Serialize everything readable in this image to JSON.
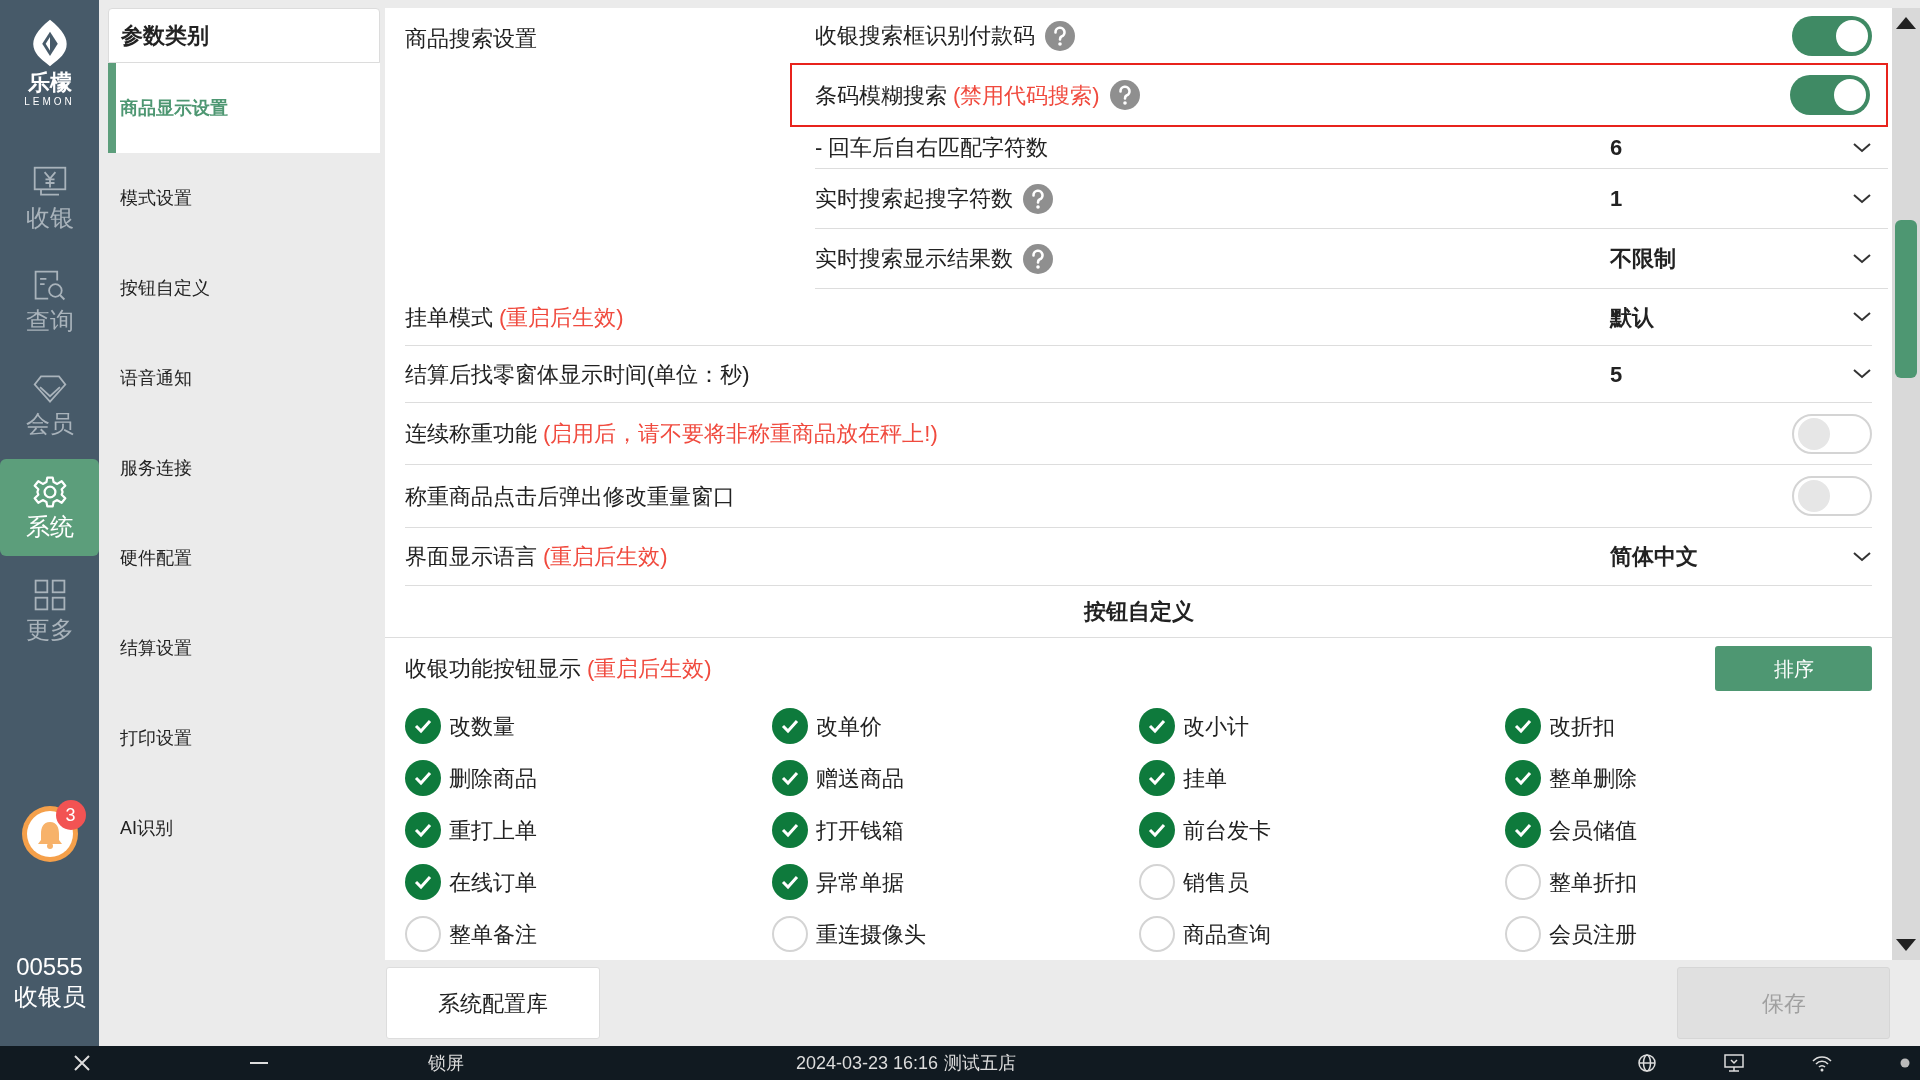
{
  "nav": {
    "logo_text": "乐檬",
    "logo_subtext": "LEMON",
    "items": [
      {
        "label": "收银",
        "kind": "register",
        "selected": false
      },
      {
        "label": "查询",
        "kind": "query",
        "selected": false
      },
      {
        "label": "会员",
        "kind": "member",
        "selected": false
      },
      {
        "label": "系统",
        "kind": "gear",
        "selected": true
      },
      {
        "label": "更多",
        "kind": "grid",
        "selected": false
      }
    ],
    "notification_count": "3",
    "user_id": "00555",
    "user_role": "收银员"
  },
  "categories": {
    "title": "参数类别",
    "items": [
      {
        "label": "商品显示设置",
        "selected": true
      },
      {
        "label": "模式设置",
        "selected": false
      },
      {
        "label": "按钮自定义",
        "selected": false
      },
      {
        "label": "语音通知",
        "selected": false
      },
      {
        "label": "服务连接",
        "selected": false
      },
      {
        "label": "硬件配置",
        "selected": false
      },
      {
        "label": "结算设置",
        "selected": false
      },
      {
        "label": "打印设置",
        "selected": false
      },
      {
        "label": "AI识别",
        "selected": false
      }
    ]
  },
  "search_settings": {
    "label": "商品搜索设置",
    "rows": [
      {
        "kind": "toggle",
        "label": "收银搜索框识别付款码",
        "help": true,
        "on": true,
        "highlighted": false
      },
      {
        "kind": "toggle",
        "label": "条码模糊搜索",
        "note": "(禁用代码搜索)",
        "help": true,
        "on": true,
        "highlighted": true
      },
      {
        "kind": "select",
        "label": "- 回车后自右匹配字符数",
        "help": false,
        "value": "6",
        "highlighted": false
      },
      {
        "kind": "select",
        "label": "实时搜索起搜字符数",
        "help": true,
        "value": "1",
        "highlighted": false
      },
      {
        "kind": "select",
        "label": "实时搜索显示结果数",
        "help": true,
        "value": "不限制",
        "highlighted": false
      }
    ]
  },
  "settings": [
    {
      "kind": "select",
      "label": "挂单模式",
      "note": "(重启后生效)",
      "value": "默认"
    },
    {
      "kind": "select",
      "label": "结算后找零窗体显示时间(单位：秒)",
      "value": "5"
    },
    {
      "kind": "toggle",
      "label": "连续称重功能",
      "note": "(启用后，请不要将非称重商品放在秤上!)",
      "on": false
    },
    {
      "kind": "toggle",
      "label": "称重商品点击后弹出修改重量窗口",
      "on": false
    },
    {
      "kind": "select",
      "label": "界面显示语言",
      "note": "(重启后生效)",
      "value": "简体中文"
    }
  ],
  "button_section": {
    "title": "按钮自定义",
    "label": "收银功能按钮显示",
    "note": "(重启后生效)",
    "sort_button": "排序",
    "options": [
      {
        "label": "改数量",
        "checked": true
      },
      {
        "label": "改单价",
        "checked": true
      },
      {
        "label": "改小计",
        "checked": true
      },
      {
        "label": "改折扣",
        "checked": true
      },
      {
        "label": "删除商品",
        "checked": true
      },
      {
        "label": "赠送商品",
        "checked": true
      },
      {
        "label": "挂单",
        "checked": true
      },
      {
        "label": "整单删除",
        "checked": true
      },
      {
        "label": "重打上单",
        "checked": true
      },
      {
        "label": "打开钱箱",
        "checked": true
      },
      {
        "label": "前台发卡",
        "checked": true
      },
      {
        "label": "会员储值",
        "checked": true
      },
      {
        "label": "在线订单",
        "checked": true
      },
      {
        "label": "异常单据",
        "checked": true
      },
      {
        "label": "销售员",
        "checked": false
      },
      {
        "label": "整单折扣",
        "checked": false
      },
      {
        "label": "整单备注",
        "checked": false
      },
      {
        "label": "重连摄像头",
        "checked": false
      },
      {
        "label": "商品查询",
        "checked": false
      },
      {
        "label": "会员注册",
        "checked": false
      }
    ]
  },
  "footer": {
    "config_button": "系统配置库",
    "save_button": "保存",
    "save_disabled": true
  },
  "taskbar": {
    "lock": "锁屏",
    "datetime": "2024-03-23 16:16",
    "store": "测试五店"
  }
}
